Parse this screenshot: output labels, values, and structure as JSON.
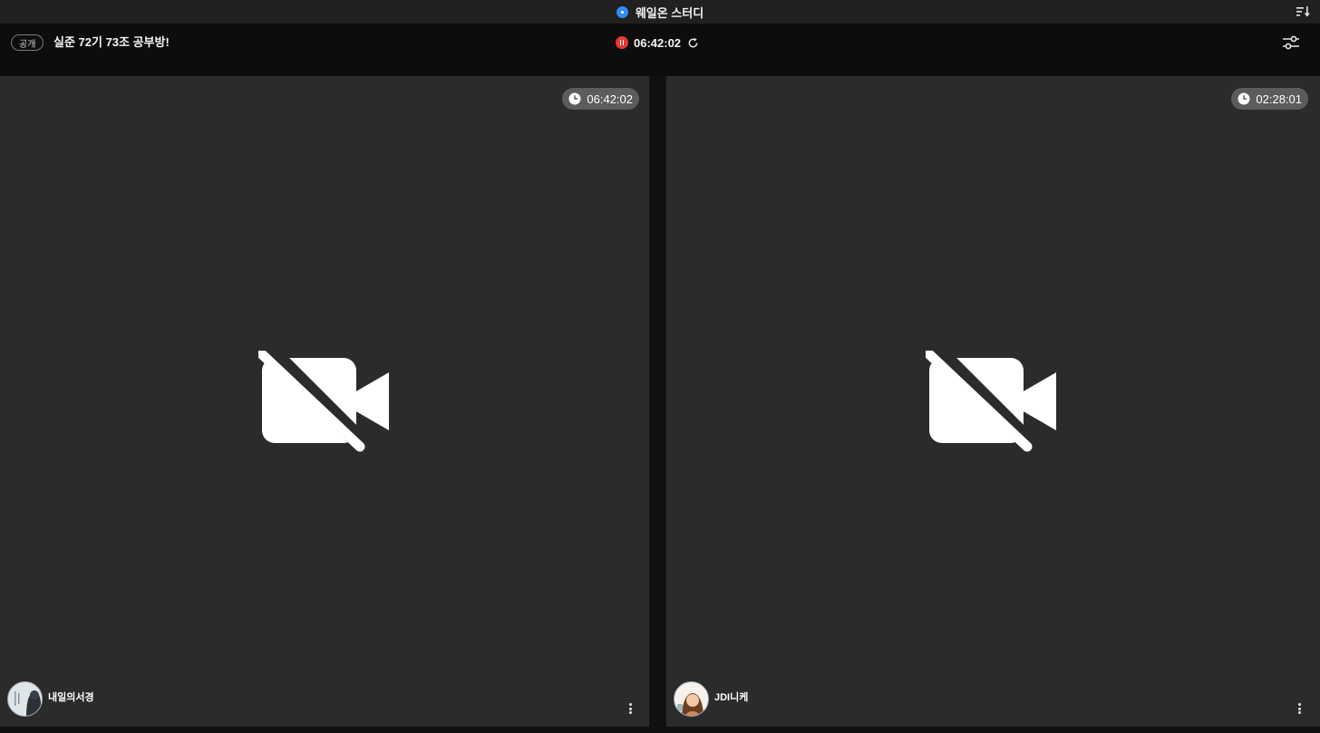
{
  "app": {
    "title": "웨일온 스터디",
    "accent_color": "#2f8ef0"
  },
  "header": {
    "visibility": "공개",
    "room_title": "실준 72기 73조 공부방!",
    "timer": "06:42:02",
    "timer_status_color": "#e53935"
  },
  "participants": [
    {
      "name": "내일의서경",
      "study_time": "06:42:02",
      "camera": "off",
      "icon": "video-off-icon"
    },
    {
      "name": "JDI니케",
      "study_time": "02:28:01",
      "camera": "off",
      "icon": "video-off-icon"
    }
  ],
  "icons": {
    "sort": "sort-icon",
    "settings": "sliders-icon",
    "refresh": "refresh-icon",
    "clock": "clock-icon",
    "more": "more-vertical-icon"
  }
}
